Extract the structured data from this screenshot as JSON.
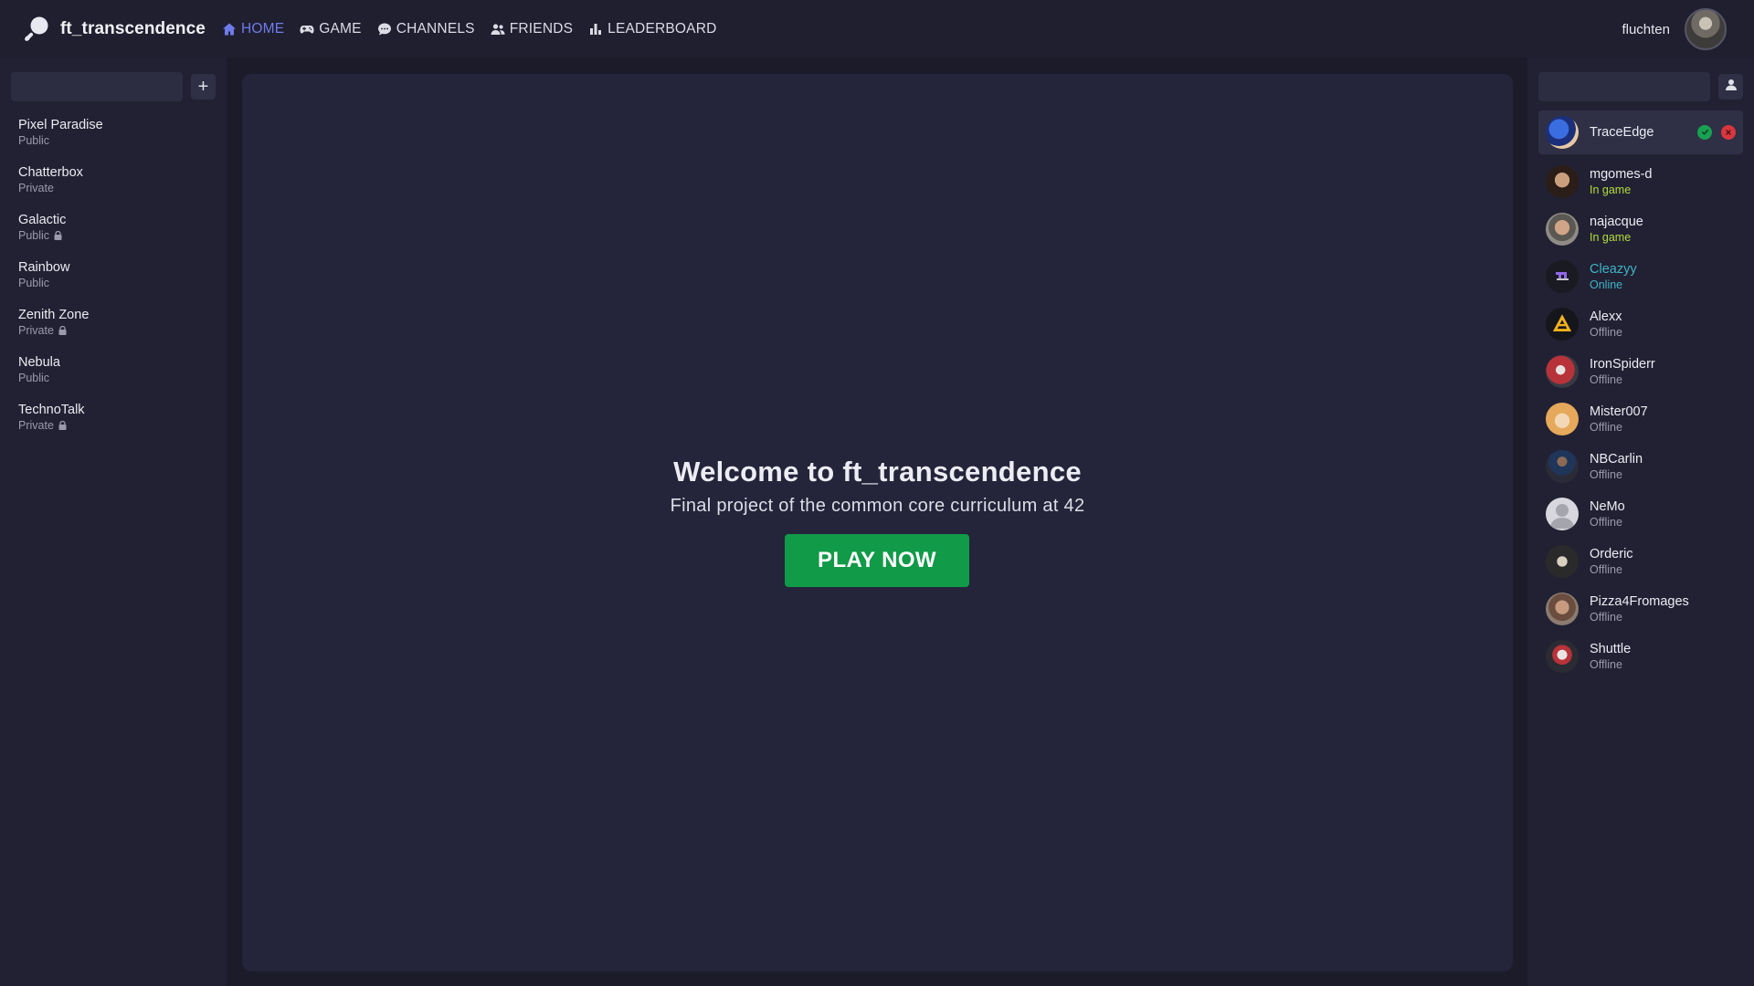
{
  "brand": {
    "name": "ft_transcendence"
  },
  "nav": [
    {
      "label": "HOME",
      "icon": "home-icon",
      "active": true
    },
    {
      "label": "GAME",
      "icon": "gamepad-icon"
    },
    {
      "label": "CHANNELS",
      "icon": "chat-icon"
    },
    {
      "label": "FRIENDS",
      "icon": "users-icon"
    },
    {
      "label": "LEADERBOARD",
      "icon": "bar-chart-icon"
    }
  ],
  "user": {
    "name": "fluchten"
  },
  "channels": [
    {
      "name": "Pixel Paradise",
      "visibility": "Public",
      "locked": false
    },
    {
      "name": "Chatterbox",
      "visibility": "Private",
      "locked": false
    },
    {
      "name": "Galactic",
      "visibility": "Public",
      "locked": true
    },
    {
      "name": "Rainbow",
      "visibility": "Public",
      "locked": false
    },
    {
      "name": "Zenith Zone",
      "visibility": "Private",
      "locked": true
    },
    {
      "name": "Nebula",
      "visibility": "Public",
      "locked": false
    },
    {
      "name": "TechnoTalk",
      "visibility": "Private",
      "locked": true
    }
  ],
  "main": {
    "title": "Welcome to ft_transcendence",
    "subtitle": "Final project of the common core curriculum at 42",
    "play_label": "PLAY NOW"
  },
  "friend_request": {
    "name": "TraceEdge"
  },
  "friends": [
    {
      "name": "mgomes-d",
      "status": "In game",
      "kind": "ingame"
    },
    {
      "name": "najacque",
      "status": "In game",
      "kind": "ingame"
    },
    {
      "name": "Cleazyy",
      "status": "Online",
      "kind": "online"
    },
    {
      "name": "Alexx",
      "status": "Offline",
      "kind": "offline"
    },
    {
      "name": "IronSpiderr",
      "status": "Offline",
      "kind": "offline"
    },
    {
      "name": "Mister007",
      "status": "Offline",
      "kind": "offline"
    },
    {
      "name": "NBCarlin",
      "status": "Offline",
      "kind": "offline"
    },
    {
      "name": "NeMo",
      "status": "Offline",
      "kind": "offline"
    },
    {
      "name": "Orderic",
      "status": "Offline",
      "kind": "offline"
    },
    {
      "name": "Pizza4Fromages",
      "status": "Offline",
      "kind": "offline"
    },
    {
      "name": "Shuttle",
      "status": "Offline",
      "kind": "offline"
    }
  ],
  "colors": {
    "accent": "#6f7be8",
    "play_button": "#119a47",
    "in_game": "#b3dc3a",
    "online": "#3fb3c7",
    "accept": "#18a151",
    "decline": "#d9363e"
  }
}
